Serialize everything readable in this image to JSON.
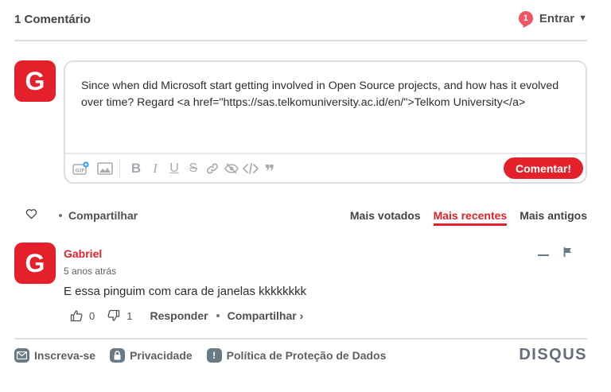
{
  "header": {
    "comment_count": "1 Comentário",
    "notification_count": "1",
    "login_label": "Entrar"
  },
  "user": {
    "avatar_letter": "G"
  },
  "composer": {
    "text": "Since when did Microsoft start getting involved in Open Source projects, and how has it evolved over time? Regard <a href=\"https://sas.telkomuniversity.ac.id/en/\">Telkom University</a>",
    "submit_label": "Comentar!",
    "toolbar_icons": [
      "gif-icon",
      "image-icon",
      "bold-icon",
      "italic-icon",
      "underline-icon",
      "strikethrough-icon",
      "link-icon",
      "spoiler-icon",
      "code-icon",
      "quote-icon"
    ]
  },
  "actions": {
    "share_label": "Compartilhar",
    "sort_options": [
      "Mais votados",
      "Mais recentes",
      "Mais antigos"
    ],
    "active_sort": "Mais recentes"
  },
  "comment": {
    "avatar_letter": "G",
    "author": "Gabriel",
    "time": "5 anos atrás",
    "body": "E essa pinguim com cara de janelas kkkkkkkk",
    "upvotes": "0",
    "downvotes": "1",
    "reply_label": "Responder",
    "share_label": "Compartilhar ›"
  },
  "footer": {
    "subscribe": "Inscreva-se",
    "privacy": "Privacidade",
    "data_policy": "Política de Proteção de Dados",
    "brand": "DISQUS"
  },
  "colors": {
    "accent": "#e4212b",
    "notification": "#ef5564",
    "border": "#dbdfe4"
  }
}
